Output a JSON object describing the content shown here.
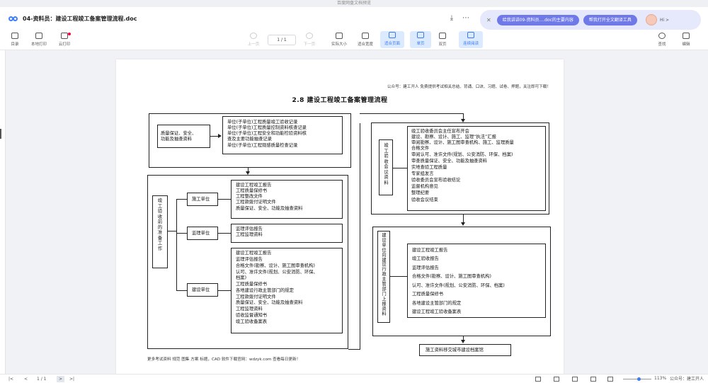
{
  "window": {
    "caption": "百度网盘文档预览"
  },
  "titlebar": {
    "title": "04-资料员：建设工程竣工备案管理流程.doc"
  },
  "ai": {
    "pill1": "给我讲讲09-资料员....doc的主要内容",
    "pill2": "帮我打开全文翻译工具",
    "hi": "Hi >"
  },
  "toolbar": {
    "items": [
      "目录",
      "本地打印",
      "云打印",
      "上一页",
      "下一页",
      "实际大小",
      "适合宽度",
      "适合页面",
      "单页",
      "双页",
      "连续阅读",
      "查找",
      "编辑"
    ],
    "page_field": "1 / 1"
  },
  "document": {
    "pub_note": "公众号：建工开人 免费提供考试相关总结、背诵、口诀、习题、试卷、押题，关注即可下载！",
    "heading": "2.8   建设工程竣工备案管理流程",
    "footer": "更多考试资料 规范 图集 方案 标题，CAD 软件下载官网：wdzyk.com  查看每日更新！",
    "topleft_label": [
      "质量保证、安全、",
      "功能及抽查资料"
    ],
    "topright_lines": [
      "单位(子单位)工程质量竣工验收记录",
      "单位(子单位)工程质量控制资料核查记录",
      "单位(子单位)工程安全和功能检验资料核",
      "查及主要功能抽查记录",
      "单位(子单位)工程观感质量检查记录"
    ],
    "prep_vertical": "竣工验收前的准备工作",
    "unit_construct": "施工单位",
    "unit_construct_lines": [
      "建设工程竣工报告",
      "工程质量保修书",
      "工程整改文件",
      "工程款拨付证明文件",
      "质量保证、安全、功能及抽查资料"
    ],
    "unit_supervise": "监理单位",
    "unit_supervise_lines": [
      "监理评估报告",
      "工程监理资料"
    ],
    "unit_build": "建设单位",
    "unit_build_lines": [
      "建设工程竣工报告",
      "监理评估报告",
      "合格文件(勘察、设计、施工图审查机构)",
      "认可、准许文件(规划、公安消防、环保、",
      "档案)",
      "工程质量保修书",
      "各地建设行政主管部门的规定",
      "工程款拨付证明文件",
      "质量保证、安全、功能及抽查资料",
      "工程监理资料",
      "验收监督通知书",
      "竣工验收备案表"
    ],
    "accept_vertical": "竣工验收会议资料",
    "accept_lines": [
      "竣工验收委员会主任宣布开会",
      "建设、勘察、设计、施工、监理“执法”汇报",
      "审阅勘察、设计、施工图审查机构、施工、监理质量",
      "合格文件",
      "审阅认可、准许文件(规划、公安消防、环保、档案)",
      "审查质量保证、安全、功能及抽查资料",
      "实地查验工程质量",
      "专家组发言",
      "验收委员会宣布验收结论",
      "监督机构意见",
      "整理纪要",
      "验收会议结束"
    ],
    "report_vertical": "建设单位向建设行政主管部门上报资料",
    "report_lines": [
      "建设工程竣工报告",
      "竣工验收报告",
      "监理评估报告",
      "合格文件(勘察、设计、施工图审查机构)",
      "认可、准许文件(规划、公安消防、环保、档案)",
      "工程质量保修书",
      "各地建设主管部门的规定",
      "建设工程竣工验收备案表"
    ],
    "final_box": "施工资料移交城市建设档案馆"
  },
  "status": {
    "page": "1 / 1",
    "zoom": "113%",
    "right_text": "公众号：建工开人"
  }
}
